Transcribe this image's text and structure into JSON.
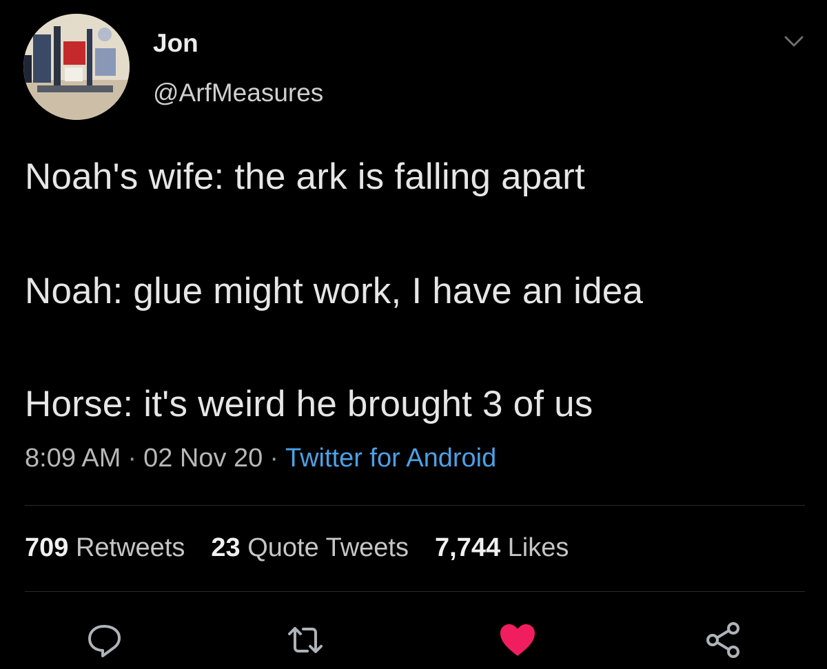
{
  "author": {
    "display_name": "Jon",
    "handle": "@ArfMeasures",
    "avatar_icon": "profile-photo"
  },
  "tweet": {
    "lines": [
      "Noah's wife: the ark is falling apart",
      "Noah: glue might work, I have an idea",
      "Horse: it's weird he brought 3 of us"
    ]
  },
  "meta": {
    "time": "8:09 AM",
    "separator": "·",
    "date": "02 Nov 20",
    "source": "Twitter for Android"
  },
  "stats": {
    "retweets_count": "709",
    "retweets_label": "Retweets",
    "quotes_count": "23",
    "quotes_label": "Quote Tweets",
    "likes_count": "7,744",
    "likes_label": "Likes"
  },
  "actions": {
    "reply_icon": "reply-icon",
    "retweet_icon": "retweet-icon",
    "like_icon": "heart-icon",
    "share_icon": "share-icon"
  },
  "colors": {
    "background": "#000000",
    "link": "#4aa1e6",
    "like": "#f01d5f"
  }
}
